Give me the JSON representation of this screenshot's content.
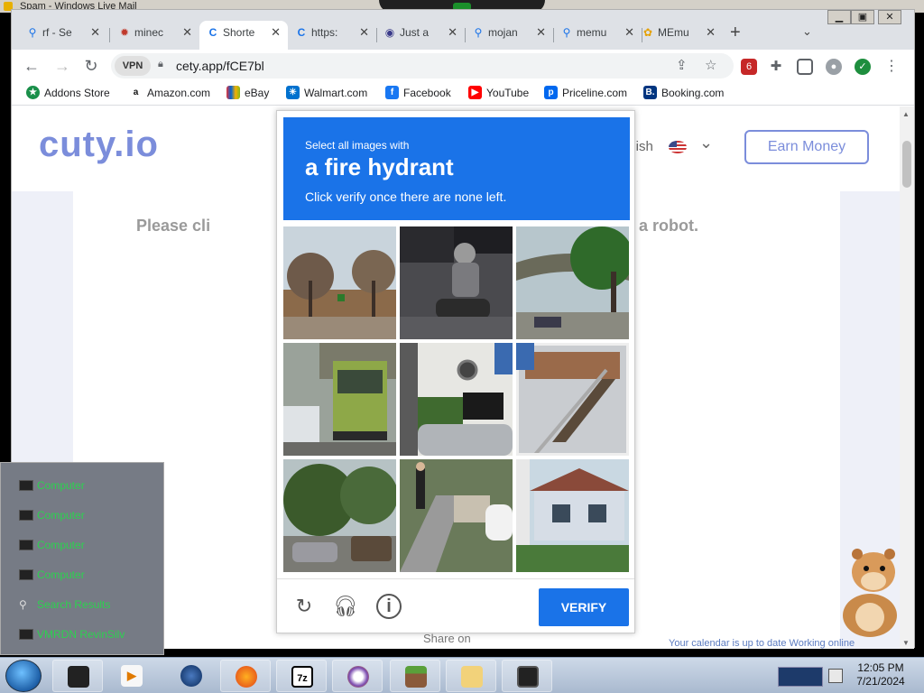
{
  "window": {
    "title": "Spam - Windows Live Mail"
  },
  "browser": {
    "tabs": [
      {
        "label": "rf - Se",
        "icon": "search-icon"
      },
      {
        "label": "minec",
        "icon": "bug-icon"
      },
      {
        "label": "Shorte",
        "icon": "cuty-icon",
        "active": true
      },
      {
        "label": "https:",
        "icon": "cuty-icon"
      },
      {
        "label": "Just a",
        "icon": "globe-icon"
      },
      {
        "label": "mojan",
        "icon": "search-icon"
      },
      {
        "label": "memu",
        "icon": "search-icon"
      },
      {
        "label": "MEmu",
        "icon": "memu-icon"
      }
    ],
    "url": "cety.app/fCE7bl",
    "vpn_badge": "VPN",
    "bookmarks": [
      {
        "label": "Addons Store",
        "icon": "addons-icon",
        "color": "#1a8f4a"
      },
      {
        "label": "Amazon.com",
        "icon": "amazon-icon",
        "color": "#111111"
      },
      {
        "label": "eBay",
        "icon": "ebay-icon",
        "color": "#e53238"
      },
      {
        "label": "Walmart.com",
        "icon": "walmart-icon",
        "color": "#0071ce"
      },
      {
        "label": "Facebook",
        "icon": "facebook-icon",
        "color": "#1877f2"
      },
      {
        "label": "YouTube",
        "icon": "youtube-icon",
        "color": "#ff0000"
      },
      {
        "label": "Priceline.com",
        "icon": "priceline-icon",
        "color": "#0068ef"
      },
      {
        "label": "Booking.com",
        "icon": "booking-icon",
        "color": "#003580"
      }
    ]
  },
  "site": {
    "logo": "cuty.io",
    "language": "glish",
    "earn_button": "Earn Money",
    "please_text": "Please cli",
    "robot_text": "t a robot.",
    "share_text": "Share on",
    "mail_status": "Your calendar is up to date   Working online"
  },
  "captcha": {
    "instruction_small": "Select all images with",
    "target": "a fire hydrant",
    "instruction_note": "Click verify once there are none left.",
    "verify_label": "VERIFY",
    "tiles": [
      "street-trees",
      "motorcycle-rider",
      "tree-overpass",
      "green-truck",
      "parked-motorcycle",
      "escalator-stairs",
      "street-trees-cars",
      "pedestrian-sidewalk",
      "house-porch"
    ]
  },
  "gadget": {
    "items": [
      {
        "label": "Computer",
        "icon": "monitor-icon"
      },
      {
        "label": "Computer",
        "icon": "monitor-icon"
      },
      {
        "label": "Computer",
        "icon": "monitor-icon"
      },
      {
        "label": "Computer",
        "icon": "monitor-icon"
      },
      {
        "label": "Search Results",
        "icon": "magnifier-icon"
      },
      {
        "label": "VMRDN RevinSilv",
        "icon": "monitor-icon"
      }
    ]
  },
  "taskbar": {
    "time": "12:05 PM",
    "date": "7/21/2024",
    "apps": [
      "computer",
      "media-player",
      "globe",
      "firefox",
      "7z",
      "tor-browser",
      "minecraft",
      "mail",
      "monitor"
    ]
  }
}
